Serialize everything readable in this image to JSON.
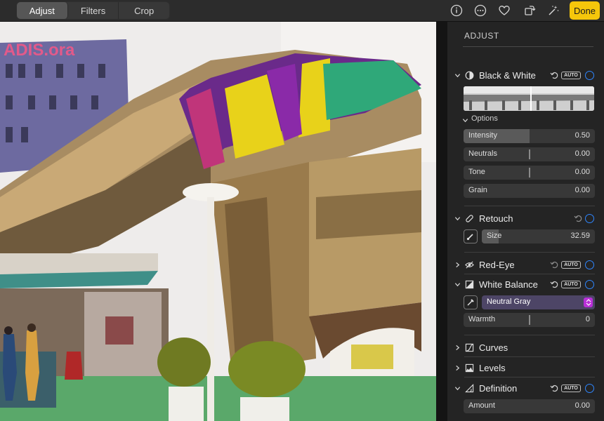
{
  "toolbar": {
    "tabs": [
      {
        "label": "Adjust",
        "active": true
      },
      {
        "label": "Filters",
        "active": false
      },
      {
        "label": "Crop",
        "active": false
      }
    ],
    "icons": [
      "info-icon",
      "more-icon",
      "heart-icon",
      "rotate-icon",
      "magic-wand-icon"
    ],
    "done_label": "Done",
    "accent_color": "#f5c60b"
  },
  "photo": {
    "sign_text": "ADIS.ora"
  },
  "sidebar": {
    "title": "ADJUST",
    "auto_label": "AUTO",
    "toggle_color": "#2f86ff",
    "black_white": {
      "label": "Black & White",
      "options_label": "Options",
      "sliders": [
        {
          "label": "Intensity",
          "value": "0.50",
          "level": 0.5
        },
        {
          "label": "Neutrals",
          "value": "0.00",
          "level": 0.5
        },
        {
          "label": "Tone",
          "value": "0.00",
          "level": 0.5
        },
        {
          "label": "Grain",
          "value": "0.00",
          "level": 0
        }
      ]
    },
    "retouch": {
      "label": "Retouch",
      "size_label": "Size",
      "size_value": "32.59",
      "level": 0.15
    },
    "red_eye": {
      "label": "Red-Eye"
    },
    "white_balance": {
      "label": "White Balance",
      "select_value": "Neutral Gray",
      "warmth_label": "Warmth",
      "warmth_value": "0",
      "warmth_level": 0.5
    },
    "curves": {
      "label": "Curves"
    },
    "levels": {
      "label": "Levels"
    },
    "definition": {
      "label": "Definition",
      "amount_label": "Amount",
      "amount_value": "0.00"
    }
  }
}
